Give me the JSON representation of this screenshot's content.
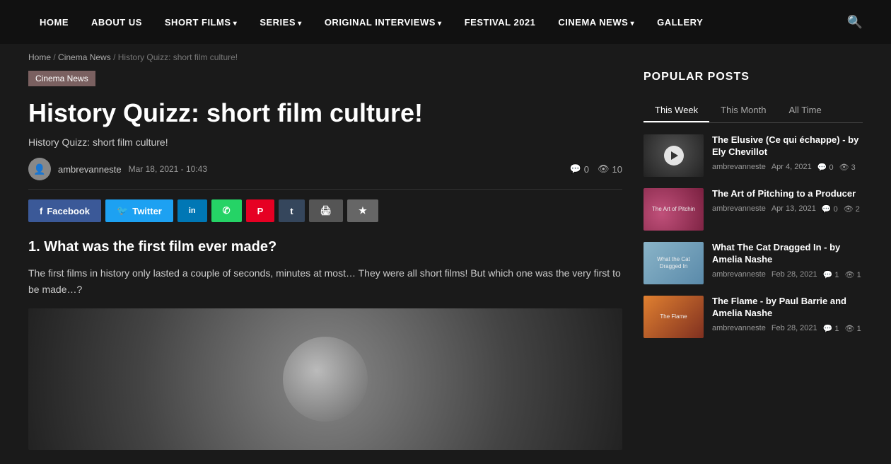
{
  "nav": {
    "items": [
      {
        "label": "HOME",
        "hasArrow": false,
        "id": "home"
      },
      {
        "label": "ABOUT US",
        "hasArrow": false,
        "id": "about"
      },
      {
        "label": "SHORT FILMS",
        "hasArrow": true,
        "id": "short-films"
      },
      {
        "label": "SERIES",
        "hasArrow": true,
        "id": "series"
      },
      {
        "label": "ORIGINAL INTERVIEWS",
        "hasArrow": true,
        "id": "original-interviews"
      },
      {
        "label": "FESTIVAL 2021",
        "hasArrow": false,
        "id": "festival"
      },
      {
        "label": "CINEMA NEWS",
        "hasArrow": true,
        "id": "cinema-news"
      },
      {
        "label": "GALLERY",
        "hasArrow": false,
        "id": "gallery"
      }
    ]
  },
  "breadcrumb": {
    "home": "Home",
    "cinema_news": "Cinema News",
    "current": "History Quizz: short film culture!"
  },
  "article": {
    "category": "Cinema News",
    "title": "History Quizz: short film culture!",
    "subtitle": "History Quizz: short film culture!",
    "author": "ambrevanneste",
    "date": "Mar 18, 2021 - 10:43",
    "comments_count": "0",
    "views_count": "10",
    "share_buttons": [
      {
        "label": "Facebook",
        "type": "facebook"
      },
      {
        "label": "Twitter",
        "type": "twitter"
      },
      {
        "label": "LinkedIn",
        "type": "linkedin"
      },
      {
        "label": "WhatsApp",
        "type": "whatsapp"
      },
      {
        "label": "Pinterest",
        "type": "pinterest"
      },
      {
        "label": "Tumblr",
        "type": "tumblr"
      },
      {
        "label": "Print",
        "type": "print"
      },
      {
        "label": "Bookmark",
        "type": "bookmark"
      }
    ],
    "question_heading": "1. What was the first film ever made?",
    "question_body": "The first films in history only lasted a couple of seconds, minutes at most… They were all short films! But which one was the very first to be made…?"
  },
  "sidebar": {
    "popular_posts_label": "POPULAR POSTS",
    "tabs": [
      {
        "label": "This Week",
        "active": true
      },
      {
        "label": "This Month",
        "active": false
      },
      {
        "label": "All Time",
        "active": false
      }
    ],
    "posts": [
      {
        "title": "The Elusive (Ce qui échappe) - by Ely Chevillot",
        "author": "ambrevanneste",
        "date": "Apr 4, 2021",
        "comments": "0",
        "views": "3",
        "thumb_type": "dark",
        "has_play": true,
        "thumb_label": ""
      },
      {
        "title": "The Art of Pitching to a Producer",
        "author": "ambrevanneste",
        "date": "Apr 13, 2021",
        "comments": "0",
        "views": "2",
        "thumb_type": "pink",
        "has_play": false,
        "thumb_label": "The Art of Pitchin"
      },
      {
        "title": "What The Cat Dragged In - by Amelia Nashe",
        "author": "ambrevanneste",
        "date": "Feb 28, 2021",
        "comments": "1",
        "views": "1",
        "thumb_type": "blue",
        "has_play": false,
        "thumb_label": "What the Cat\nDragged In"
      },
      {
        "title": "The Flame - by Paul Barrie and Amelia Nashe",
        "author": "ambrevanneste",
        "date": "Feb 28, 2021",
        "comments": "1",
        "views": "1",
        "thumb_type": "orange",
        "has_play": false,
        "thumb_label": "The Flame"
      }
    ]
  },
  "icons": {
    "search": "🔍",
    "comment": "💬",
    "eye": "👁",
    "facebook_f": "f",
    "twitter_bird": "🐦",
    "linkedin_in": "in",
    "whatsapp_w": "✆",
    "pinterest_p": "P",
    "tumblr_t": "t",
    "print_p": "🖨",
    "bookmark_star": "★",
    "play_triangle": "▶"
  }
}
